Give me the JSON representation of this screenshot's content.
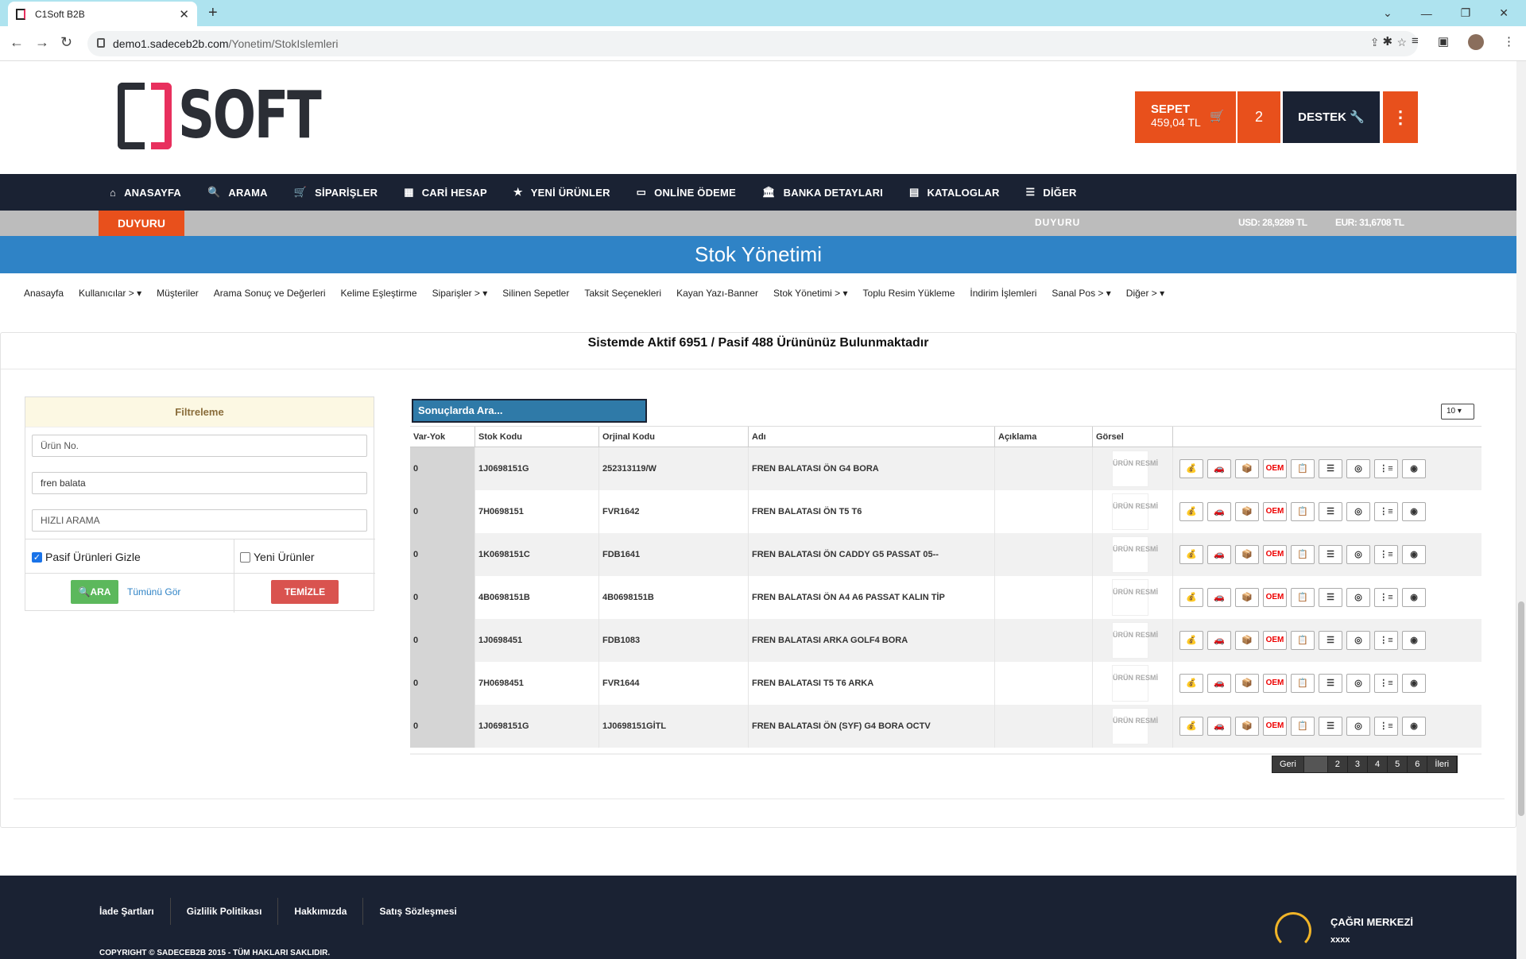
{
  "browser": {
    "tab_title": "C1Soft B2B",
    "url_host": "demo1.sadeceb2b.com",
    "url_path": "/Yonetim/StokIslemleri"
  },
  "header": {
    "logo_text": "SOFT",
    "sepet_label": "SEPET",
    "sepet_total": "459,04 TL",
    "cart_count": "2",
    "destek_label": "DESTEK"
  },
  "mainnav": [
    {
      "icon": "home-icon",
      "label": "ANASAYFA"
    },
    {
      "icon": "search-icon",
      "label": "ARAMA"
    },
    {
      "icon": "cart-icon",
      "label": "SİPARİŞLER"
    },
    {
      "icon": "calculator-icon",
      "label": "CARİ HESAP"
    },
    {
      "icon": "star-icon",
      "label": "YENİ ÜRÜNLER"
    },
    {
      "icon": "credit-card-icon",
      "label": "ONLİNE ÖDEME"
    },
    {
      "icon": "bank-icon",
      "label": "BANKA DETAYLARI"
    },
    {
      "icon": "map-icon",
      "label": "KATALOGLAR"
    },
    {
      "icon": "list-icon",
      "label": "DİĞER"
    }
  ],
  "announcement": {
    "label": "DUYURU",
    "text": "DUYURU",
    "usd": "USD: 28,9289 TL",
    "eur": "EUR: 31,6708 TL"
  },
  "page_title": "Stok Yönetimi",
  "subnav": [
    "Anasayfa",
    "Kullanıcılar > ▾",
    "Müşteriler",
    "Arama Sonuç ve Değerleri",
    "Kelime Eşleştirme",
    "Siparişler > ▾",
    "Silinen Sepetler",
    "Taksit Seçenekleri",
    "Kayan Yazı-Banner",
    "Stok Yönetimi > ▾",
    "Toplu Resim Yükleme",
    "İndirim İşlemleri",
    "Sanal Pos > ▾",
    "Diğer > ▾"
  ],
  "summary": "Sistemde Aktif 6951 / Pasif 488 Ürününüz Bulunmaktadır",
  "filter": {
    "title": "Filtreleme",
    "urun_no_placeholder": "Ürün No.",
    "keyword_value": "fren balata",
    "hizli_placeholder": "HIZLI ARAMA",
    "pasif_label": "Pasif Ürünleri Gizle",
    "pasif_checked": true,
    "yeni_label": "Yeni Ürünler",
    "yeni_checked": false,
    "ara_label": "ARA",
    "tumunu_label": "Tümünü Gör",
    "temizle_label": "TEMİZLE"
  },
  "results": {
    "search_placeholder": "Sonuçlarda Ara...",
    "page_size": "10",
    "columns": [
      "Var-Yok",
      "Stok Kodu",
      "Orjinal Kodu",
      "Adı",
      "Açıklama",
      "Görsel",
      ""
    ],
    "image_placeholder": "ÜRÜN RESMİ",
    "action_icons": [
      "coins-icon",
      "car-icon",
      "box-icon",
      "oem-icon",
      "clipboard-icon",
      "list-icon",
      "tag-icon",
      "tree-icon",
      "globe-icon"
    ],
    "oem_label": "OEM",
    "rows": [
      {
        "var_yok": "0",
        "stok_kodu": "1J0698151G",
        "orjinal_kodu": "252313119/W",
        "adi": "FREN BALATASI ÖN G4 BORA",
        "aciklama": ""
      },
      {
        "var_yok": "0",
        "stok_kodu": "7H0698151",
        "orjinal_kodu": "FVR1642",
        "adi": "FREN BALATASI ÖN T5 T6",
        "aciklama": ""
      },
      {
        "var_yok": "0",
        "stok_kodu": "1K0698151C",
        "orjinal_kodu": "FDB1641",
        "adi": "FREN BALATASI ÖN CADDY G5 PASSAT 05--",
        "aciklama": ""
      },
      {
        "var_yok": "0",
        "stok_kodu": "4B0698151B",
        "orjinal_kodu": "4B0698151B",
        "adi": "FREN BALATASI ÖN A4 A6 PASSAT KALIN TİP",
        "aciklama": ""
      },
      {
        "var_yok": "0",
        "stok_kodu": "1J0698451",
        "orjinal_kodu": "FDB1083",
        "adi": "FREN BALATASI ARKA GOLF4 BORA",
        "aciklama": ""
      },
      {
        "var_yok": "0",
        "stok_kodu": "7H0698451",
        "orjinal_kodu": "FVR1644",
        "adi": "FREN BALATASI T5 T6 ARKA",
        "aciklama": ""
      },
      {
        "var_yok": "0",
        "stok_kodu": "1J0698151G",
        "orjinal_kodu": "1J0698151GİTL",
        "adi": "FREN BALATASI ÖN (SYF) G4 BORA OCTV",
        "aciklama": ""
      }
    ]
  },
  "pager": {
    "prev": "Geri",
    "current": "",
    "pages": [
      "2",
      "3",
      "4",
      "5",
      "6"
    ],
    "next": "İleri"
  },
  "footer": {
    "links": [
      "İade Şartları",
      "Gizlilik Politikası",
      "Hakkımızda",
      "Satış Sözleşmesi"
    ],
    "copyright": "COPYRIGHT © SADECEB2B 2015 - TÜM HAKLARI SAKLIDIR.",
    "call_title": "ÇAĞRI MERKEZİ",
    "call_number": "xxxx"
  },
  "colors": {
    "accent": "#e8501c",
    "navy": "#1a2233",
    "blue": "#2f83c6",
    "green": "#5cb85c",
    "red": "#d9534f"
  }
}
